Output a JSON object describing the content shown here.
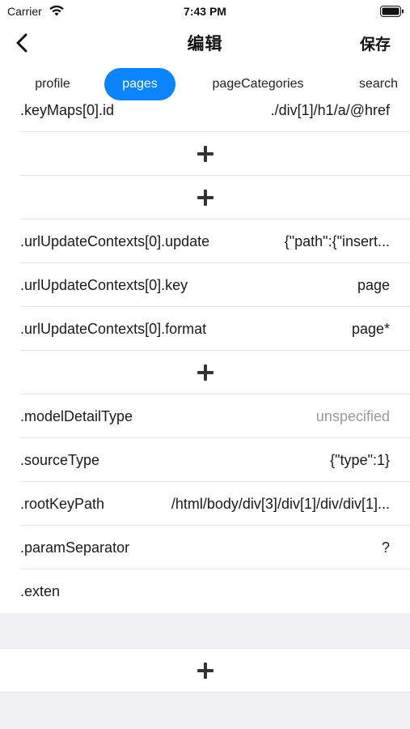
{
  "status": {
    "carrier": "Carrier",
    "time": "7:43 PM"
  },
  "nav": {
    "title": "编辑",
    "save_label": "保存",
    "back_icon": "chevron-left-icon"
  },
  "tabs": [
    {
      "label": "profile",
      "active": false
    },
    {
      "label": "pages",
      "active": true
    },
    {
      "label": "pageCategories",
      "active": false
    },
    {
      "label": "search",
      "active": false
    }
  ],
  "rows": {
    "keymaps_id": {
      "key": ".keyMaps[0].id",
      "value": "./div[1]/h1/a/@href"
    },
    "url_update": {
      "key": ".urlUpdateContexts[0].update",
      "value": "{\"path\":{\"insert..."
    },
    "url_key": {
      "key": ".urlUpdateContexts[0].key",
      "value": "page"
    },
    "url_format": {
      "key": ".urlUpdateContexts[0].format",
      "value": "page*"
    },
    "model_detail": {
      "key": ".modelDetailType",
      "value": "unspecified"
    },
    "source_type": {
      "key": ".sourceType",
      "value": "{\"type\":1}"
    },
    "root_key_path": {
      "key": ".rootKeyPath",
      "value": "/html/body/div[3]/div[1]/div/div[1]..."
    },
    "param_sep": {
      "key": ".paramSeparator",
      "value": "?"
    },
    "exten": {
      "key": ".exten",
      "value": ""
    }
  },
  "colors": {
    "accent": "#0a84ff",
    "placeholder": "#9a9a9a",
    "separator": "#e3e3e3",
    "group_bg": "#f0f0f3"
  }
}
